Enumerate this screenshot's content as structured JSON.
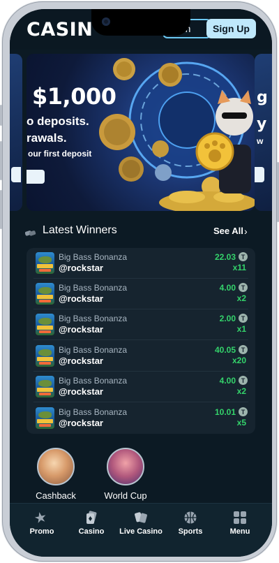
{
  "header": {
    "logo_text": "CASIN",
    "signin_label": "in",
    "signup_label": "Sign Up"
  },
  "banner": {
    "amount": "$1,000",
    "line1": "o deposits.",
    "line2": "rawals.",
    "line3": "our first deposit",
    "side_right_t1": "g",
    "side_right_t2": "y",
    "side_right_t3": "w"
  },
  "latest_winners": {
    "title": "Latest Winners",
    "see_all": "See All",
    "rows": [
      {
        "game": "Big Bass Bonanza",
        "user": "@rockstar",
        "amount": "22.03",
        "multiplier": "x11"
      },
      {
        "game": "Big Bass Bonanza",
        "user": "@rockstar",
        "amount": "4.00",
        "multiplier": "x2"
      },
      {
        "game": "Big Bass Bonanza",
        "user": "@rockstar",
        "amount": "2.00",
        "multiplier": "x1"
      },
      {
        "game": "Big Bass Bonanza",
        "user": "@rockstar",
        "amount": "40.05",
        "multiplier": "x20"
      },
      {
        "game": "Big Bass Bonanza",
        "user": "@rockstar",
        "amount": "4.00",
        "multiplier": "x2"
      },
      {
        "game": "Big Bass Bonanza",
        "user": "@rockstar",
        "amount": "10.01",
        "multiplier": "x5"
      }
    ],
    "coin_symbol": "T"
  },
  "promos": [
    {
      "label": "Cashback"
    },
    {
      "label": "World Cup"
    }
  ],
  "bottom_nav": [
    {
      "label": "Promo",
      "icon": "star-icon"
    },
    {
      "label": "Casino",
      "icon": "cards-icon"
    },
    {
      "label": "Live Casino",
      "icon": "live-cards-icon"
    },
    {
      "label": "Sports",
      "icon": "basketball-icon"
    },
    {
      "label": "Menu",
      "icon": "grid-icon"
    }
  ],
  "colors": {
    "background": "#0c1a24",
    "accent": "#bfe8fb",
    "win_green": "#34d36b"
  }
}
